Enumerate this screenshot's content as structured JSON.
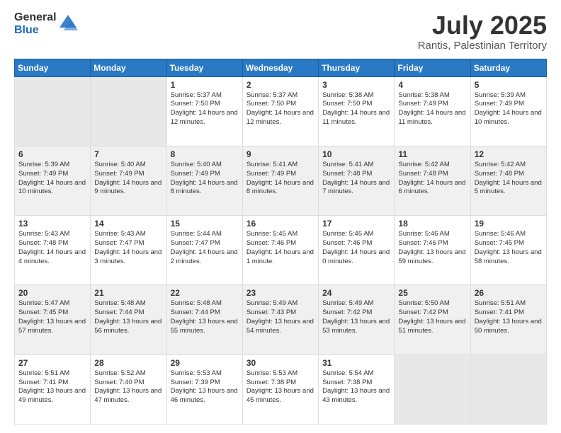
{
  "header": {
    "logo_general": "General",
    "logo_blue": "Blue",
    "title": "July 2025",
    "subtitle": "Rantis, Palestinian Territory"
  },
  "days_of_week": [
    "Sunday",
    "Monday",
    "Tuesday",
    "Wednesday",
    "Thursday",
    "Friday",
    "Saturday"
  ],
  "weeks": [
    [
      {
        "day": "",
        "info": ""
      },
      {
        "day": "",
        "info": ""
      },
      {
        "day": "1",
        "info": "Sunrise: 5:37 AM\nSunset: 7:50 PM\nDaylight: 14 hours and 12 minutes."
      },
      {
        "day": "2",
        "info": "Sunrise: 5:37 AM\nSunset: 7:50 PM\nDaylight: 14 hours and 12 minutes."
      },
      {
        "day": "3",
        "info": "Sunrise: 5:38 AM\nSunset: 7:50 PM\nDaylight: 14 hours and 11 minutes."
      },
      {
        "day": "4",
        "info": "Sunrise: 5:38 AM\nSunset: 7:49 PM\nDaylight: 14 hours and 11 minutes."
      },
      {
        "day": "5",
        "info": "Sunrise: 5:39 AM\nSunset: 7:49 PM\nDaylight: 14 hours and 10 minutes."
      }
    ],
    [
      {
        "day": "6",
        "info": "Sunrise: 5:39 AM\nSunset: 7:49 PM\nDaylight: 14 hours and 10 minutes."
      },
      {
        "day": "7",
        "info": "Sunrise: 5:40 AM\nSunset: 7:49 PM\nDaylight: 14 hours and 9 minutes."
      },
      {
        "day": "8",
        "info": "Sunrise: 5:40 AM\nSunset: 7:49 PM\nDaylight: 14 hours and 8 minutes."
      },
      {
        "day": "9",
        "info": "Sunrise: 5:41 AM\nSunset: 7:49 PM\nDaylight: 14 hours and 8 minutes."
      },
      {
        "day": "10",
        "info": "Sunrise: 5:41 AM\nSunset: 7:48 PM\nDaylight: 14 hours and 7 minutes."
      },
      {
        "day": "11",
        "info": "Sunrise: 5:42 AM\nSunset: 7:48 PM\nDaylight: 14 hours and 6 minutes."
      },
      {
        "day": "12",
        "info": "Sunrise: 5:42 AM\nSunset: 7:48 PM\nDaylight: 14 hours and 5 minutes."
      }
    ],
    [
      {
        "day": "13",
        "info": "Sunrise: 5:43 AM\nSunset: 7:48 PM\nDaylight: 14 hours and 4 minutes."
      },
      {
        "day": "14",
        "info": "Sunrise: 5:43 AM\nSunset: 7:47 PM\nDaylight: 14 hours and 3 minutes."
      },
      {
        "day": "15",
        "info": "Sunrise: 5:44 AM\nSunset: 7:47 PM\nDaylight: 14 hours and 2 minutes."
      },
      {
        "day": "16",
        "info": "Sunrise: 5:45 AM\nSunset: 7:46 PM\nDaylight: 14 hours and 1 minute."
      },
      {
        "day": "17",
        "info": "Sunrise: 5:45 AM\nSunset: 7:46 PM\nDaylight: 14 hours and 0 minutes."
      },
      {
        "day": "18",
        "info": "Sunrise: 5:46 AM\nSunset: 7:46 PM\nDaylight: 13 hours and 59 minutes."
      },
      {
        "day": "19",
        "info": "Sunrise: 5:46 AM\nSunset: 7:45 PM\nDaylight: 13 hours and 58 minutes."
      }
    ],
    [
      {
        "day": "20",
        "info": "Sunrise: 5:47 AM\nSunset: 7:45 PM\nDaylight: 13 hours and 57 minutes."
      },
      {
        "day": "21",
        "info": "Sunrise: 5:48 AM\nSunset: 7:44 PM\nDaylight: 13 hours and 56 minutes."
      },
      {
        "day": "22",
        "info": "Sunrise: 5:48 AM\nSunset: 7:44 PM\nDaylight: 13 hours and 55 minutes."
      },
      {
        "day": "23",
        "info": "Sunrise: 5:49 AM\nSunset: 7:43 PM\nDaylight: 13 hours and 54 minutes."
      },
      {
        "day": "24",
        "info": "Sunrise: 5:49 AM\nSunset: 7:42 PM\nDaylight: 13 hours and 53 minutes."
      },
      {
        "day": "25",
        "info": "Sunrise: 5:50 AM\nSunset: 7:42 PM\nDaylight: 13 hours and 51 minutes."
      },
      {
        "day": "26",
        "info": "Sunrise: 5:51 AM\nSunset: 7:41 PM\nDaylight: 13 hours and 50 minutes."
      }
    ],
    [
      {
        "day": "27",
        "info": "Sunrise: 5:51 AM\nSunset: 7:41 PM\nDaylight: 13 hours and 49 minutes."
      },
      {
        "day": "28",
        "info": "Sunrise: 5:52 AM\nSunset: 7:40 PM\nDaylight: 13 hours and 47 minutes."
      },
      {
        "day": "29",
        "info": "Sunrise: 5:53 AM\nSunset: 7:39 PM\nDaylight: 13 hours and 46 minutes."
      },
      {
        "day": "30",
        "info": "Sunrise: 5:53 AM\nSunset: 7:38 PM\nDaylight: 13 hours and 45 minutes."
      },
      {
        "day": "31",
        "info": "Sunrise: 5:54 AM\nSunset: 7:38 PM\nDaylight: 13 hours and 43 minutes."
      },
      {
        "day": "",
        "info": ""
      },
      {
        "day": "",
        "info": ""
      }
    ]
  ]
}
